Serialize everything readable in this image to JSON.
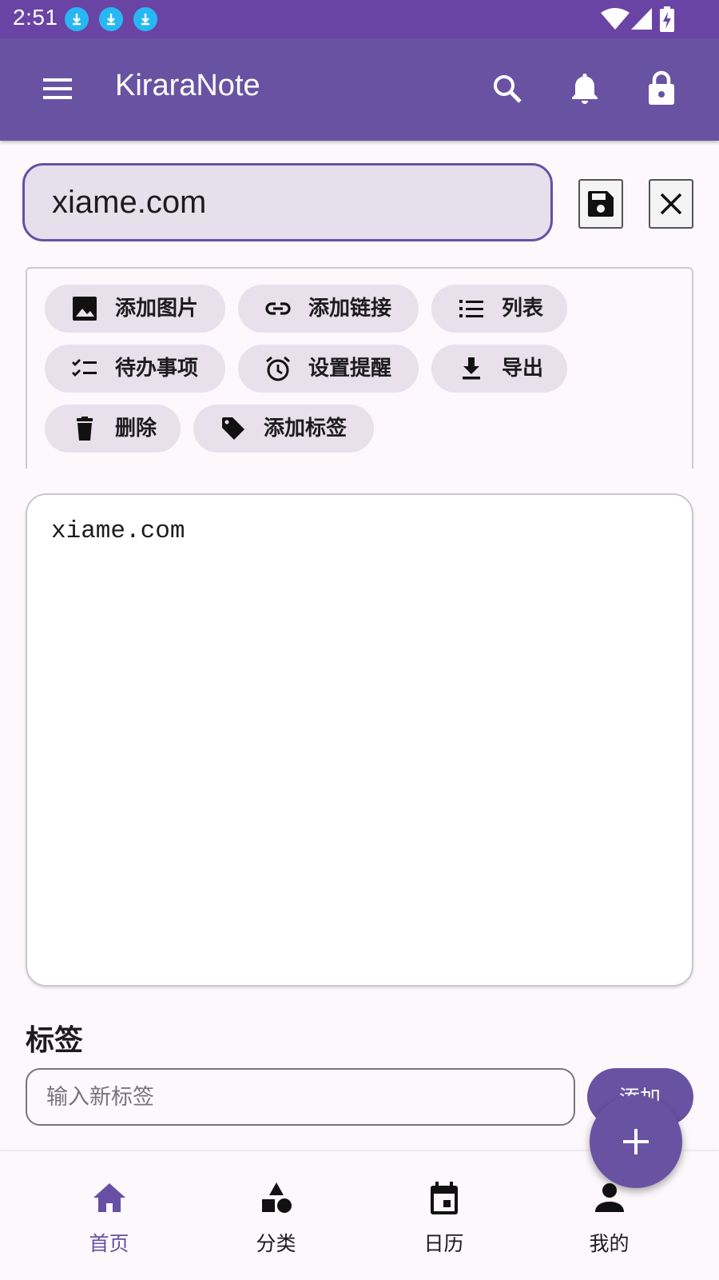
{
  "status_bar": {
    "time": "2:51"
  },
  "app_bar": {
    "title": "KiraraNote"
  },
  "editor": {
    "title_value": "xiame.com",
    "content": "xiame.com"
  },
  "toolbar": {
    "chips": [
      {
        "label": "添加图片",
        "icon": "image-icon"
      },
      {
        "label": "添加链接",
        "icon": "link-icon"
      },
      {
        "label": "列表",
        "icon": "list-icon"
      },
      {
        "label": "待办事项",
        "icon": "checklist-icon"
      },
      {
        "label": "设置提醒",
        "icon": "alarm-icon"
      },
      {
        "label": "导出",
        "icon": "download-icon"
      },
      {
        "label": "删除",
        "icon": "trash-icon"
      },
      {
        "label": "添加标签",
        "icon": "tag-icon"
      }
    ]
  },
  "tags": {
    "title": "标签",
    "input_placeholder": "输入新标签",
    "add_label": "添加"
  },
  "bottom_nav": {
    "items": [
      {
        "label": "首页",
        "icon": "home-icon",
        "active": true
      },
      {
        "label": "分类",
        "icon": "category-icon"
      },
      {
        "label": "日历",
        "icon": "calendar-icon"
      },
      {
        "label": "我的",
        "icon": "person-icon"
      }
    ]
  },
  "colors": {
    "primary": "#6750a4",
    "status_bar": "#6a44a4",
    "chip_background": "#e8e0ea",
    "download_badge": "#27b7f2"
  }
}
